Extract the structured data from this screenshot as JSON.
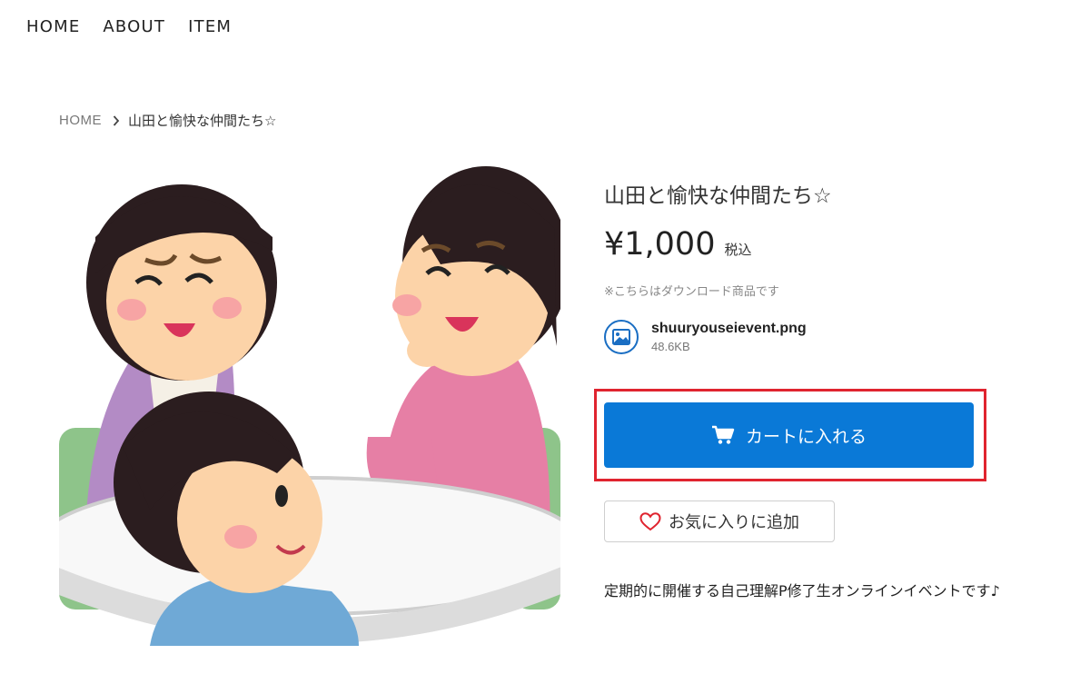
{
  "nav": {
    "items": [
      "HOME",
      "ABOUT",
      "ITEM"
    ]
  },
  "breadcrumb": {
    "home": "HOME",
    "current": "山田と愉快な仲間たち☆"
  },
  "product": {
    "title": "山田と愉快な仲間たち☆",
    "price": "¥1,000",
    "tax_label": "税込",
    "download_note": "※こちらはダウンロード商品です",
    "file": {
      "name": "shuuryouseievent.png",
      "size": "48.6KB",
      "icon": "image-icon"
    },
    "cart_button": "カートに入れる",
    "favorite_button": "お気に入りに追加",
    "description": "定期的に開催する自己理解P修了生オンラインイベントです♪"
  },
  "colors": {
    "primary": "#0a79d7",
    "highlight": "#e0242f",
    "heart": "#e0242f"
  }
}
